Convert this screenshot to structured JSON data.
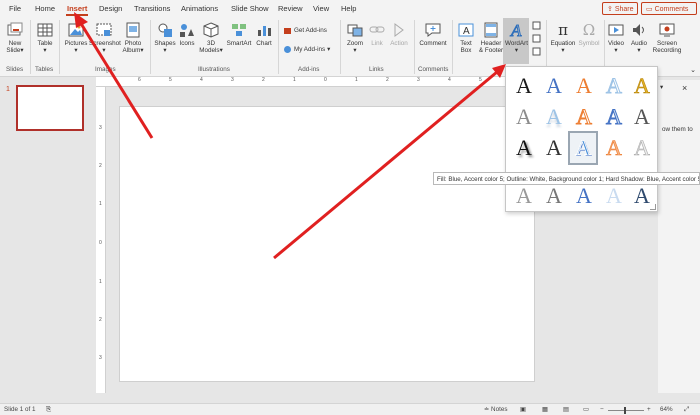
{
  "tabs": [
    "File",
    "Home",
    "Insert",
    "Design",
    "Transitions",
    "Animations",
    "Slide Show",
    "Review",
    "View",
    "Help"
  ],
  "active_tab": "Insert",
  "top_right": {
    "share": "Share",
    "comments": "Comments"
  },
  "ribbon": {
    "new_slide": [
      "New",
      "Slide"
    ],
    "table": "Table",
    "pictures": "Pictures",
    "screenshot": "Screenshot",
    "photo_album": [
      "Photo",
      "Album"
    ],
    "shapes": "Shapes",
    "icons": "Icons",
    "models_3d": [
      "3D",
      "Models"
    ],
    "smartart": "SmartArt",
    "chart": "Chart",
    "get_addins": "Get Add-ins",
    "my_addins": "My Add-ins",
    "zoom": "Zoom",
    "link": "Link",
    "action": "Action",
    "comment": "Comment",
    "text_box": [
      "Text",
      "Box"
    ],
    "header_footer": [
      "Header",
      "& Footer"
    ],
    "wordart": "WordArt",
    "equation": "Equation",
    "symbol": "Symbol",
    "video": "Video",
    "audio": "Audio",
    "screen_recording": [
      "Screen",
      "Recording"
    ]
  },
  "group_labels": [
    "Slides",
    "Tables",
    "Images",
    "Illustrations",
    "Add-ins",
    "Links",
    "Comments"
  ],
  "thumbnail": {
    "number": "1"
  },
  "ruler_numbers": {
    "top": [
      "6",
      "5",
      "4",
      "3",
      "2",
      "1",
      "0",
      "1",
      "2",
      "3",
      "4",
      "5",
      "6"
    ],
    "left": [
      "3",
      "2",
      "1",
      "0",
      "1",
      "2",
      "3"
    ]
  },
  "wordart_letter": "A",
  "wordart_colors": {
    "black": "#1a1a1a",
    "blue": "#4472c4",
    "orange": "#ed7d31",
    "gold": "#e2b22b",
    "gray": "#8c8c8c",
    "light_blue": "#9dc3e6"
  },
  "tooltip": "Fill: Blue, Accent color 5; Outline: White, Background color 1; Hard Shadow: Blue, Accent color 5",
  "right_pane": {
    "text": "ow them to",
    "close": "×"
  },
  "status": {
    "slide": "Slide 1 of 1",
    "notes": "Notes",
    "zoom": "64%"
  },
  "accent_color": "#c43e1c",
  "annotation_arrow_color": "#e02020"
}
